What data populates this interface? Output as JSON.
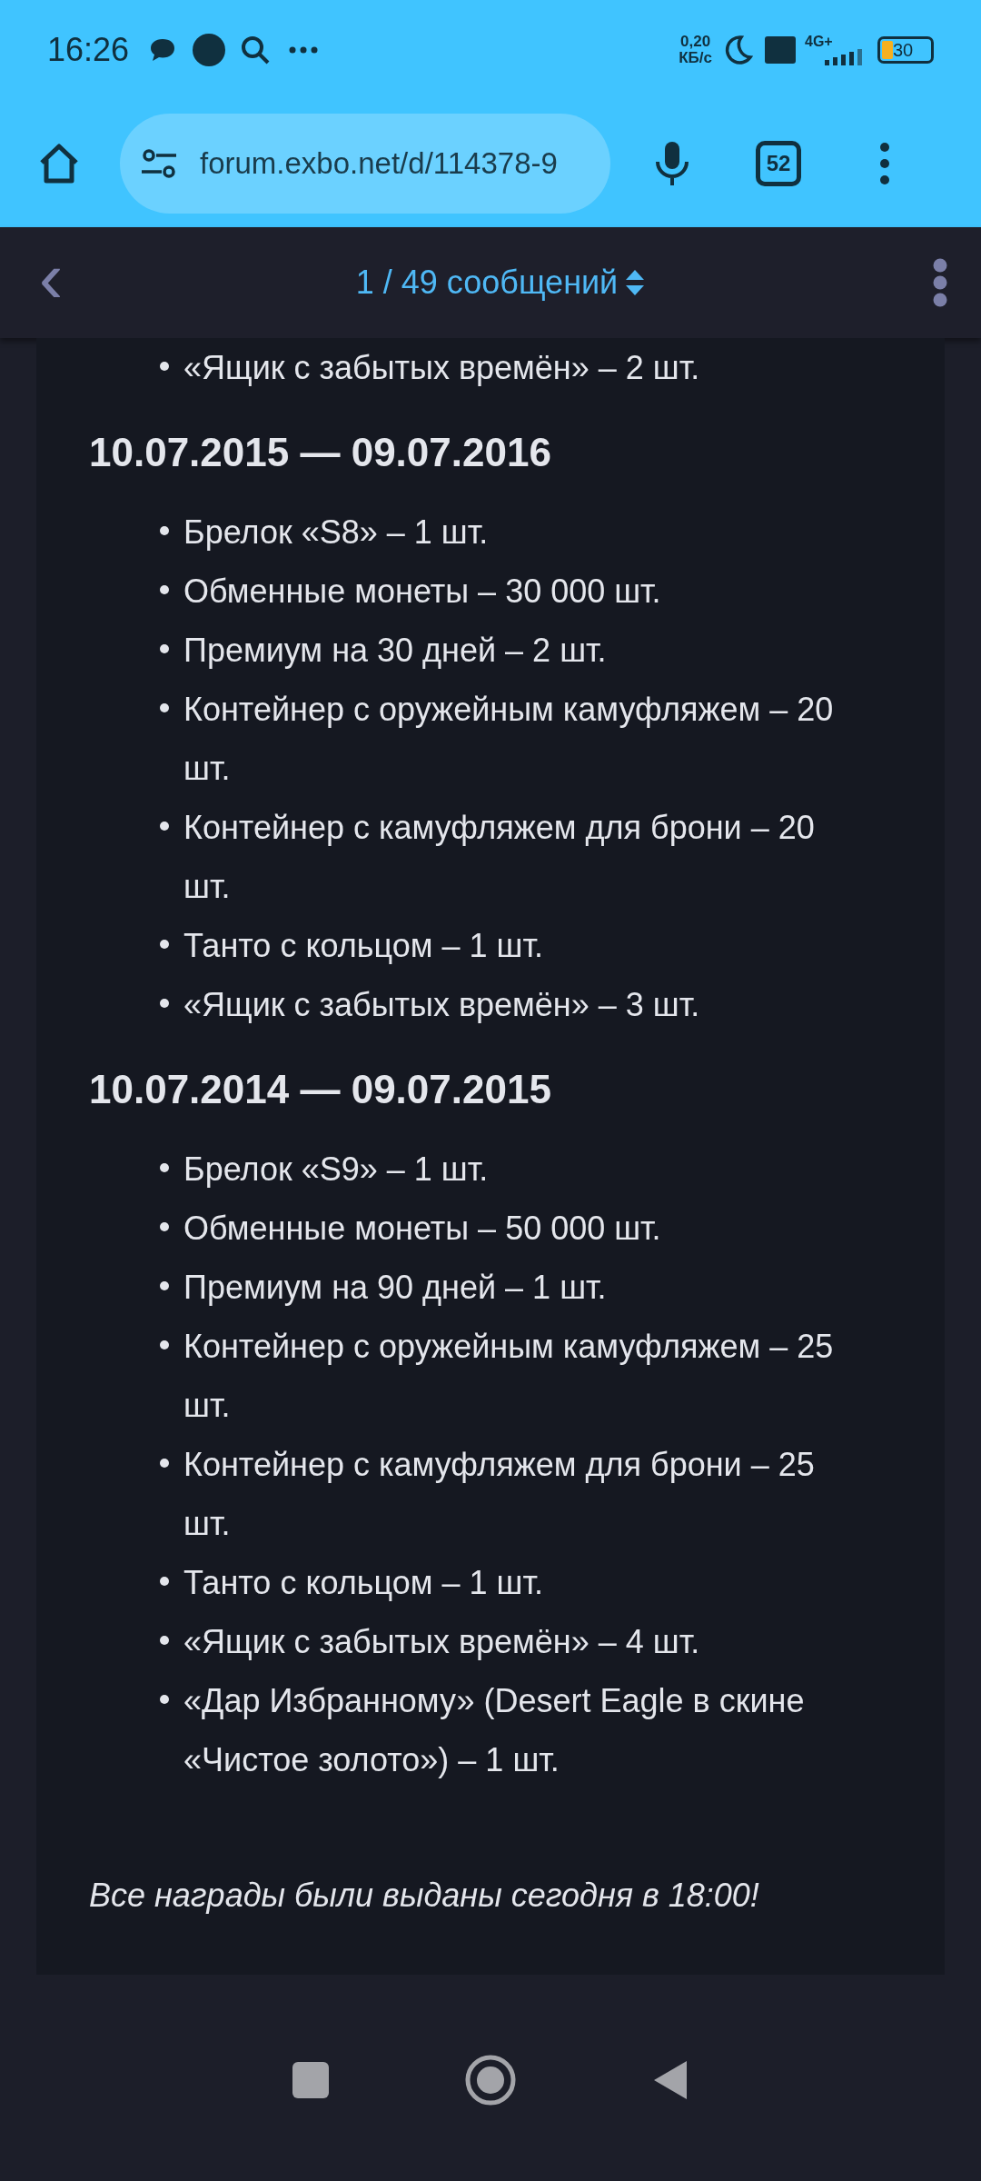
{
  "status_bar": {
    "time": "16:26",
    "net_speed": "0,20\nКБ/с",
    "network": "4G+",
    "battery": "30"
  },
  "browser": {
    "url": "forum.exbo.net/d/114378-9",
    "tab_count": "52"
  },
  "forum_header": {
    "back": "‹",
    "counter": "1 / 49 сообщений"
  },
  "post": {
    "lead_items": [
      "«Ящик с забытых времён» – 2 шт."
    ],
    "sections": [
      {
        "heading": "10.07.2015 — 09.07.2016",
        "items": [
          "Брелок «S8» – 1 шт.",
          "Обменные монеты – 30 000 шт.",
          "Премиум на 30 дней – 2 шт.",
          "Контейнер с оружейным камуфляжем – 20 шт.",
          "Контейнер с камуфляжем для брони – 20 шт.",
          "Танто с кольцом – 1 шт.",
          "«Ящик с забытых времён» – 3 шт."
        ]
      },
      {
        "heading": "10.07.2014 — 09.07.2015",
        "items": [
          "Брелок «S9» – 1 шт.",
          "Обменные монеты – 50 000 шт.",
          "Премиум на 90 дней – 1 шт.",
          "Контейнер с оружейным камуфляжем – 25 шт.",
          "Контейнер с камуфляжем для брони – 25 шт.",
          "Танто с кольцом – 1 шт.",
          "«Ящик с забытых времён» – 4 шт.",
          "«Дар Избранному» (Desert Eagle в скине «Чистое золото») – 1 шт."
        ]
      }
    ],
    "note": "Все награды были выданы сегодня в 18:00!"
  }
}
